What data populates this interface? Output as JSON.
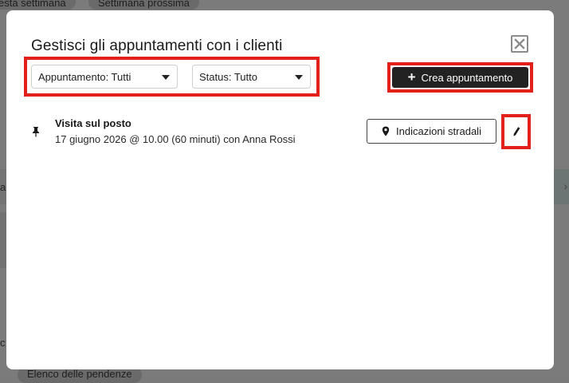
{
  "background": {
    "chip_this_week": "esta settimana",
    "chip_next_week": "Settimana prossima",
    "chip_pending_list": "Elenco delle pendenze",
    "side_text_1": "al",
    "side_text_2": "c"
  },
  "modal": {
    "title": "Gestisci gli appuntamenti con i clienti",
    "close_icon": "close-icon",
    "filters": {
      "appointment_type": {
        "label": "Appuntamento: Tutti",
        "icon": "chevron-down-icon"
      },
      "status": {
        "label": "Status: Tutto",
        "icon": "chevron-down-icon"
      }
    },
    "create_button": {
      "icon": "plus-icon",
      "label": "Crea appuntamento"
    },
    "appointments": [
      {
        "icon": "pin-icon",
        "title": "Visita sul posto",
        "detail": "17 giugno 2026 @ 10.00 (60 minuti) con Anna Rossi",
        "directions_button": {
          "icon": "map-marker-icon",
          "label": "Indicazioni stradali"
        },
        "edit_icon": "pencil-icon"
      }
    ]
  },
  "colors": {
    "highlight": "#e3211b",
    "primary_button": "#222222",
    "overlay": "#7b7b7b"
  }
}
